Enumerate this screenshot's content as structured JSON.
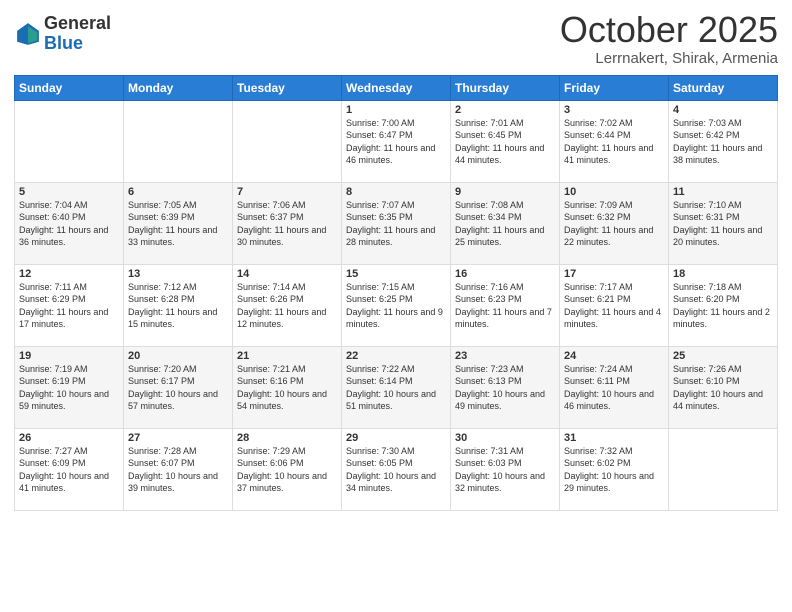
{
  "logo": {
    "general": "General",
    "blue": "Blue"
  },
  "header": {
    "month": "October 2025",
    "location": "Lerrnakert, Shirak, Armenia"
  },
  "days_of_week": [
    "Sunday",
    "Monday",
    "Tuesday",
    "Wednesday",
    "Thursday",
    "Friday",
    "Saturday"
  ],
  "weeks": [
    [
      {
        "day": "",
        "info": ""
      },
      {
        "day": "",
        "info": ""
      },
      {
        "day": "",
        "info": ""
      },
      {
        "day": "1",
        "info": "Sunrise: 7:00 AM\nSunset: 6:47 PM\nDaylight: 11 hours\nand 46 minutes."
      },
      {
        "day": "2",
        "info": "Sunrise: 7:01 AM\nSunset: 6:45 PM\nDaylight: 11 hours\nand 44 minutes."
      },
      {
        "day": "3",
        "info": "Sunrise: 7:02 AM\nSunset: 6:44 PM\nDaylight: 11 hours\nand 41 minutes."
      },
      {
        "day": "4",
        "info": "Sunrise: 7:03 AM\nSunset: 6:42 PM\nDaylight: 11 hours\nand 38 minutes."
      }
    ],
    [
      {
        "day": "5",
        "info": "Sunrise: 7:04 AM\nSunset: 6:40 PM\nDaylight: 11 hours\nand 36 minutes."
      },
      {
        "day": "6",
        "info": "Sunrise: 7:05 AM\nSunset: 6:39 PM\nDaylight: 11 hours\nand 33 minutes."
      },
      {
        "day": "7",
        "info": "Sunrise: 7:06 AM\nSunset: 6:37 PM\nDaylight: 11 hours\nand 30 minutes."
      },
      {
        "day": "8",
        "info": "Sunrise: 7:07 AM\nSunset: 6:35 PM\nDaylight: 11 hours\nand 28 minutes."
      },
      {
        "day": "9",
        "info": "Sunrise: 7:08 AM\nSunset: 6:34 PM\nDaylight: 11 hours\nand 25 minutes."
      },
      {
        "day": "10",
        "info": "Sunrise: 7:09 AM\nSunset: 6:32 PM\nDaylight: 11 hours\nand 22 minutes."
      },
      {
        "day": "11",
        "info": "Sunrise: 7:10 AM\nSunset: 6:31 PM\nDaylight: 11 hours\nand 20 minutes."
      }
    ],
    [
      {
        "day": "12",
        "info": "Sunrise: 7:11 AM\nSunset: 6:29 PM\nDaylight: 11 hours\nand 17 minutes."
      },
      {
        "day": "13",
        "info": "Sunrise: 7:12 AM\nSunset: 6:28 PM\nDaylight: 11 hours\nand 15 minutes."
      },
      {
        "day": "14",
        "info": "Sunrise: 7:14 AM\nSunset: 6:26 PM\nDaylight: 11 hours\nand 12 minutes."
      },
      {
        "day": "15",
        "info": "Sunrise: 7:15 AM\nSunset: 6:25 PM\nDaylight: 11 hours\nand 9 minutes."
      },
      {
        "day": "16",
        "info": "Sunrise: 7:16 AM\nSunset: 6:23 PM\nDaylight: 11 hours\nand 7 minutes."
      },
      {
        "day": "17",
        "info": "Sunrise: 7:17 AM\nSunset: 6:21 PM\nDaylight: 11 hours\nand 4 minutes."
      },
      {
        "day": "18",
        "info": "Sunrise: 7:18 AM\nSunset: 6:20 PM\nDaylight: 11 hours\nand 2 minutes."
      }
    ],
    [
      {
        "day": "19",
        "info": "Sunrise: 7:19 AM\nSunset: 6:19 PM\nDaylight: 10 hours\nand 59 minutes."
      },
      {
        "day": "20",
        "info": "Sunrise: 7:20 AM\nSunset: 6:17 PM\nDaylight: 10 hours\nand 57 minutes."
      },
      {
        "day": "21",
        "info": "Sunrise: 7:21 AM\nSunset: 6:16 PM\nDaylight: 10 hours\nand 54 minutes."
      },
      {
        "day": "22",
        "info": "Sunrise: 7:22 AM\nSunset: 6:14 PM\nDaylight: 10 hours\nand 51 minutes."
      },
      {
        "day": "23",
        "info": "Sunrise: 7:23 AM\nSunset: 6:13 PM\nDaylight: 10 hours\nand 49 minutes."
      },
      {
        "day": "24",
        "info": "Sunrise: 7:24 AM\nSunset: 6:11 PM\nDaylight: 10 hours\nand 46 minutes."
      },
      {
        "day": "25",
        "info": "Sunrise: 7:26 AM\nSunset: 6:10 PM\nDaylight: 10 hours\nand 44 minutes."
      }
    ],
    [
      {
        "day": "26",
        "info": "Sunrise: 7:27 AM\nSunset: 6:09 PM\nDaylight: 10 hours\nand 41 minutes."
      },
      {
        "day": "27",
        "info": "Sunrise: 7:28 AM\nSunset: 6:07 PM\nDaylight: 10 hours\nand 39 minutes."
      },
      {
        "day": "28",
        "info": "Sunrise: 7:29 AM\nSunset: 6:06 PM\nDaylight: 10 hours\nand 37 minutes."
      },
      {
        "day": "29",
        "info": "Sunrise: 7:30 AM\nSunset: 6:05 PM\nDaylight: 10 hours\nand 34 minutes."
      },
      {
        "day": "30",
        "info": "Sunrise: 7:31 AM\nSunset: 6:03 PM\nDaylight: 10 hours\nand 32 minutes."
      },
      {
        "day": "31",
        "info": "Sunrise: 7:32 AM\nSunset: 6:02 PM\nDaylight: 10 hours\nand 29 minutes."
      },
      {
        "day": "",
        "info": ""
      }
    ]
  ]
}
